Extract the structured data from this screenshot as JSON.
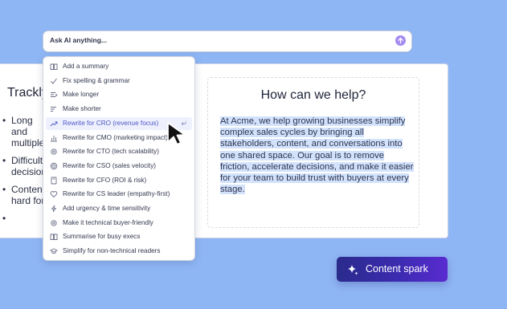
{
  "ask_bar": {
    "placeholder": "Ask AI anything..."
  },
  "left_doc": {
    "title": "Trackly",
    "bullets": [
      "Long and multiple",
      "Difficult decision",
      "Content hard for",
      ""
    ]
  },
  "right_doc": {
    "title": "How can we help?",
    "body": "At Acme, we help growing businesses simplify complex sales cycles by bringing all stakeholders, content, and conversations into one shared space. Our goal is to remove friction, accelerate decisions, and make it easier for your team to build trust with buyers at every stage."
  },
  "menu": {
    "items": [
      {
        "label": "Add a summary",
        "icon": "book-icon"
      },
      {
        "label": "Fix spelling & grammar",
        "icon": "check-icon"
      },
      {
        "label": "Make longer",
        "icon": "lines-longer-icon"
      },
      {
        "label": "Make shorter",
        "icon": "lines-shorter-icon"
      },
      {
        "label": "Rewrite for CRO (revenue focus)",
        "icon": "trend-up-icon",
        "active": true,
        "shortcut": "↵"
      },
      {
        "label": "Rewrite for CMO (marketing impact)",
        "icon": "bar-chart-icon"
      },
      {
        "label": "Rewrite for CTO (tech scalability)",
        "icon": "gear-icon"
      },
      {
        "label": "Rewrite for CSO (sales velocity)",
        "icon": "target-icon"
      },
      {
        "label": "Rewrite for CFO (ROI & risk)",
        "icon": "calculator-icon"
      },
      {
        "label": "Rewrite for CS leader (empathy-first)",
        "icon": "heart-icon"
      },
      {
        "label": "Add urgency & time sensitivity",
        "icon": "lightning-icon"
      },
      {
        "label": "Make it technical buyer-friendly",
        "icon": "gear-icon"
      },
      {
        "label": "Summarise for busy execs",
        "icon": "book-icon"
      },
      {
        "label": "Simplify for non-technical readers",
        "icon": "graduation-cap-icon"
      }
    ]
  },
  "spark_button": {
    "label": "Content spark",
    "icon": "sparkle-icon"
  },
  "colors": {
    "background": "#8fb6f4",
    "accent": "#4e56c8",
    "highlight": "#d3e2fb"
  }
}
